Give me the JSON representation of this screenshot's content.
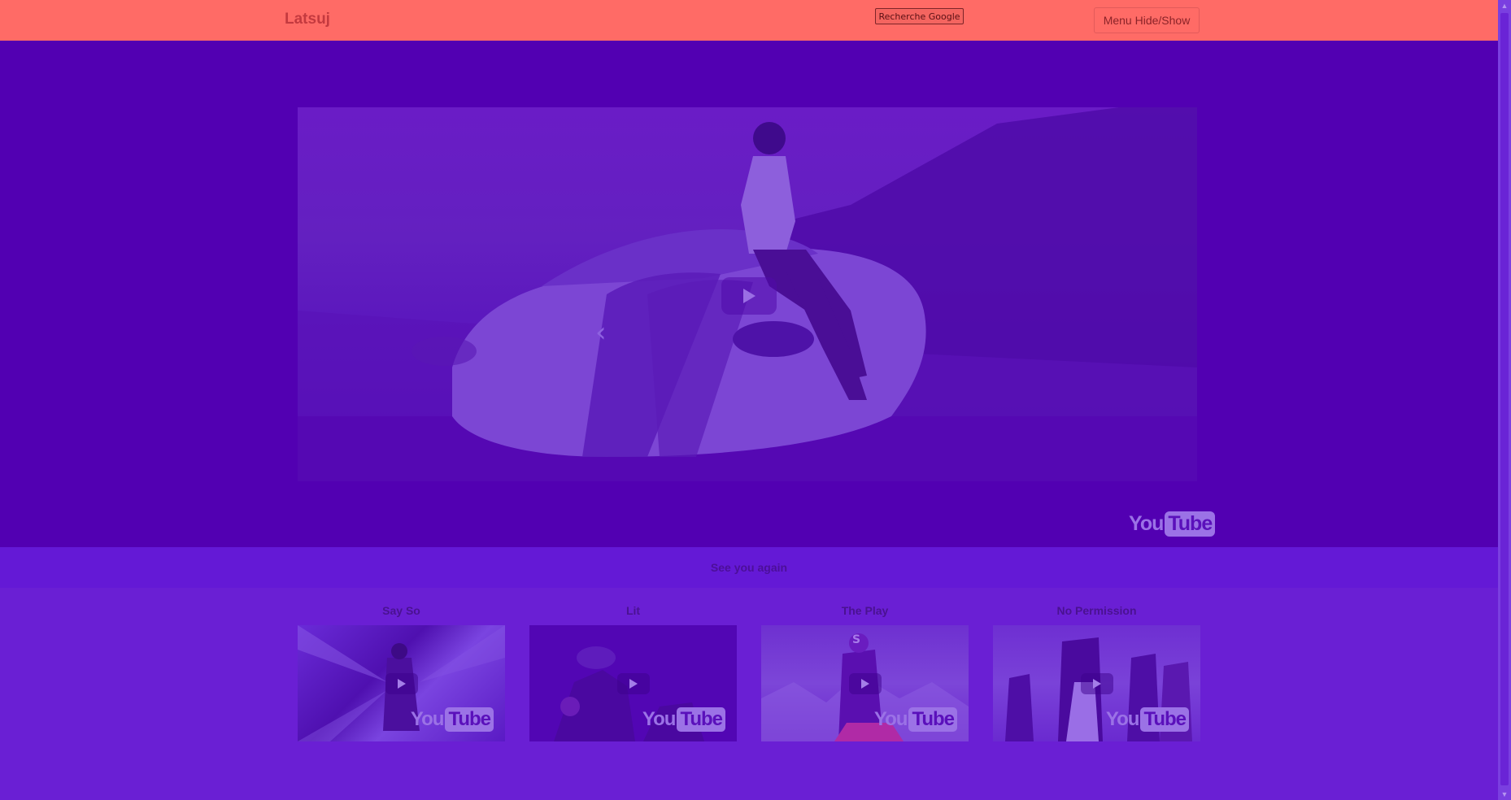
{
  "navbar": {
    "brand": "Latsuj",
    "google_button": "Recherche Google",
    "menu_button": "Menu Hide/Show"
  },
  "hero": {
    "prev_arrow": "‹",
    "next_arrow": "›",
    "youtube_you": "You",
    "youtube_tube": "Tube"
  },
  "featured_caption": "See you again",
  "videos": [
    {
      "title": "Say So",
      "yt_you": "You",
      "yt_tube": "Tube"
    },
    {
      "title": "Lit",
      "yt_you": "You",
      "yt_tube": "Tube"
    },
    {
      "title": "The Play",
      "yt_you": "You",
      "yt_tube": "Tube"
    },
    {
      "title": "No Permission",
      "yt_you": "You",
      "yt_tube": "Tube"
    }
  ],
  "colors": {
    "navbar": "#ff6b66",
    "hero_bg": "#5200b2",
    "page_bg": "#6a1fd4",
    "caption_band": "#6419d6"
  }
}
